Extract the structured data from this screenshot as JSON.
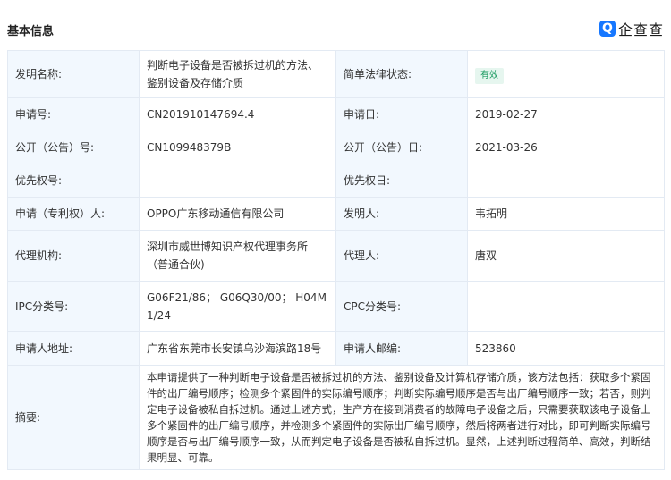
{
  "section_title": "基本信息",
  "brand": {
    "icon_letter": "Q",
    "name": "企查查"
  },
  "fields": {
    "invention_name_label": "发明名称:",
    "invention_name": "判断电子设备是否被拆过机的方法、鉴别设备及存储介质",
    "legal_status_label": "简单法律状态:",
    "legal_status": "有效",
    "app_no_label": "申请号:",
    "app_no": "CN201910147694.4",
    "app_date_label": "申请日:",
    "app_date": "2019-02-27",
    "pub_no_label": "公开（公告）号:",
    "pub_no": "CN109948379B",
    "pub_date_label": "公开（公告）日:",
    "pub_date": "2021-03-26",
    "priority_no_label": "优先权号:",
    "priority_no": "-",
    "priority_date_label": "优先权日:",
    "priority_date": "-",
    "applicant_label": "申请（专利权）人:",
    "applicant": "OPPO广东移动通信有限公司",
    "inventor_label": "发明人:",
    "inventor": "韦拓明",
    "agency_label": "代理机构:",
    "agency": "深圳市威世博知识产权代理事务所（普通合伙)",
    "agent_label": "代理人:",
    "agent": "唐双",
    "ipc_label": "IPC分类号:",
    "ipc": "G06F21/86； G06Q30/00； H04M1/24",
    "cpc_label": "CPC分类号:",
    "cpc": "-",
    "address_label": "申请人地址:",
    "address": "广东省东莞市长安镇乌沙海滨路18号",
    "postcode_label": "申请人邮编:",
    "postcode": "523860",
    "abstract_label": "摘要:",
    "abstract": "本申请提供了一种判断电子设备是否被拆过机的方法、鉴别设备及计算机存储介质，该方法包括：获取多个紧固件的出厂编号顺序；检测多个紧固件的实际编号顺序；判断实际编号顺序是否与出厂编号顺序一致；若否，则判定电子设备被私自拆过机。通过上述方式，生产方在接到消费者的故障电子设备之后，只需要获取该电子设备上多个紧固件的出厂编号顺序，并检测多个紧固件的实际出厂编号顺序，然后将两者进行对比，即可判断实际编号顺序是否与出厂编号顺序一致，从而判定电子设备是否被私自拆过机。显然，上述判断过程简单、高效，判断结果明显、可靠。"
  }
}
